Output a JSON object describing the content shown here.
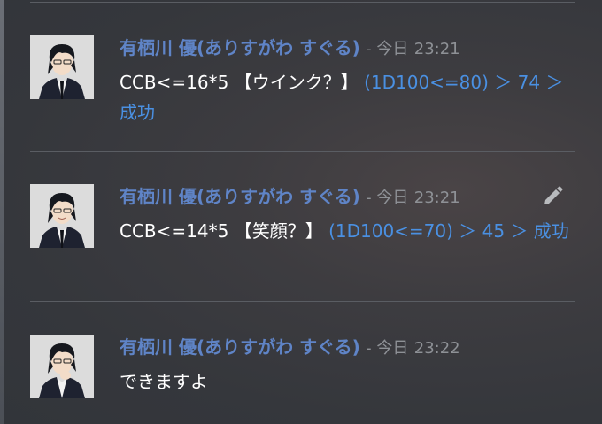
{
  "messages": [
    {
      "author": "有栖川 優(ありすがわ すぐる)",
      "separator": "- 今日",
      "time": "23:21",
      "command": "CCB<=16*5 【ウインク？】",
      "roll_text": "(1D100<=80) ＞ 74 ＞ 成功",
      "avatar": "avatar-pose-1",
      "edit_icon": false
    },
    {
      "author": "有栖川 優(ありすがわ すぐる)",
      "separator": "- 今日",
      "time": "23:21",
      "command": "CCB<=14*5 【笑顔？】",
      "roll_text": "(1D100<=70) ＞ 45 ＞ 成功",
      "avatar": "avatar-pose-2",
      "edit_icon": "pencil-icon"
    },
    {
      "author": "有栖川 優(ありすがわ すぐる)",
      "separator": "- 今日",
      "time": "23:22",
      "text": "できますよ",
      "avatar": "avatar-pose-3",
      "edit_icon": false
    }
  ],
  "colors": {
    "author": "#5f84c7",
    "timestamp": "#8e9196",
    "roll_result": "#4a90e2",
    "message_text": "#ffffff",
    "background": "#35373c"
  }
}
